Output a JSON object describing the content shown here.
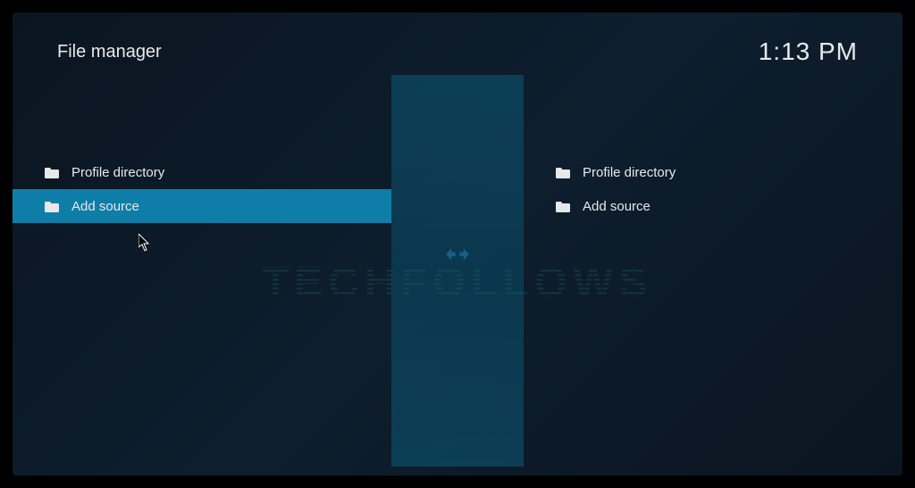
{
  "header": {
    "title": "File manager",
    "clock": "1:13 PM"
  },
  "leftPane": {
    "items": [
      {
        "label": "Profile directory",
        "selected": false
      },
      {
        "label": "Add source",
        "selected": true
      }
    ]
  },
  "rightPane": {
    "items": [
      {
        "label": "Profile directory",
        "selected": false
      },
      {
        "label": "Add source",
        "selected": false
      }
    ]
  },
  "watermark": "TECHFOLLOWS"
}
